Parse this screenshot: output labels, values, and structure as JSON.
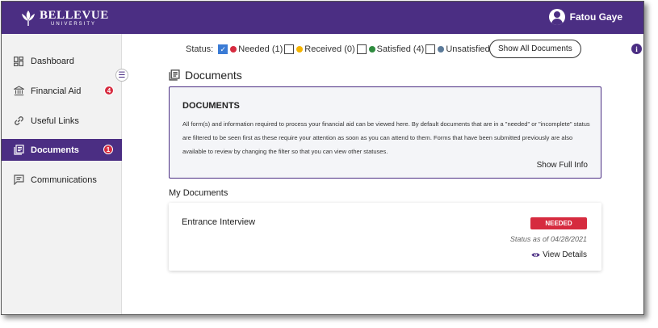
{
  "header": {
    "logo_main": "BELLEVUE",
    "logo_sub": "UNIVERSITY",
    "user_name": "Fatou Gaye",
    "brand_color": "#4b2e83"
  },
  "sidebar": {
    "items": [
      {
        "label": "Dashboard",
        "icon": "grid-icon"
      },
      {
        "label": "Financial Aid",
        "icon": "bank-icon",
        "badge": "4"
      },
      {
        "label": "Useful Links",
        "icon": "link-icon"
      },
      {
        "label": "Documents",
        "icon": "document-icon",
        "badge": "1",
        "active": true
      },
      {
        "label": "Communications",
        "icon": "chat-icon"
      }
    ]
  },
  "status_filter": {
    "label": "Status:",
    "options": [
      {
        "label": "Needed (1)",
        "checked": true,
        "color": "#d62b3f"
      },
      {
        "label": "Received (0)",
        "checked": false,
        "color": "#f5b400"
      },
      {
        "label": "Satisfied (4)",
        "checked": false,
        "color": "#2e8b3e"
      },
      {
        "label": "Unsatisfied (0)",
        "checked": false,
        "color": "#5b7a99"
      }
    ],
    "show_all_label": "Show All Documents"
  },
  "documents": {
    "heading": "Documents",
    "info_title": "DOCUMENTS",
    "info_text": "All form(s) and information required to process your financial aid can be viewed here. By default documents that are in a \"needed\" or \"incomplete\" status are filtered to be seen first as these require your attention as soon as you can attend to them. Forms that have been submitted previously are also available to review by changing the filter so that you can view other statuses.",
    "show_full_info": "Show Full Info",
    "my_documents_label": "My Documents",
    "items": [
      {
        "name": "Entrance Interview",
        "status": "NEEDED",
        "status_date": "Status as of 04/28/2021",
        "view_details": "View Details"
      }
    ]
  }
}
